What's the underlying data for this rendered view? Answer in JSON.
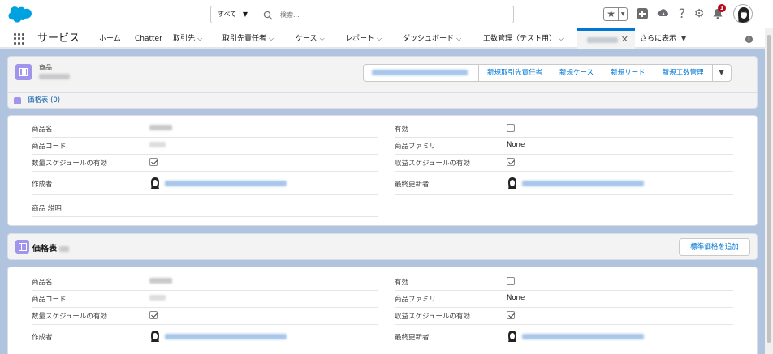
{
  "header": {
    "search_scope": "すべて",
    "search_placeholder": "検索...",
    "notification_count": "1"
  },
  "nav": {
    "app_name": "サービス",
    "items": [
      {
        "label": "ホーム"
      },
      {
        "label": "Chatter"
      },
      {
        "label": "取引先"
      },
      {
        "label": "取引先責任者"
      },
      {
        "label": "ケース"
      },
      {
        "label": "レポート"
      },
      {
        "label": "ダッシュボード"
      },
      {
        "label": "工数管理（テスト用）"
      }
    ],
    "more_label": "さらに表示"
  },
  "record_header": {
    "object_type": "商品",
    "actions": [
      "新規取引先責任者",
      "新規ケース",
      "新規リード",
      "新規工数管理"
    ],
    "related_link": "価格表 (0)"
  },
  "fields_labels": {
    "product_name": "商品名",
    "product_code": "商品コード",
    "qty_schedule": "数量スケジュールの有効",
    "created_by": "作成者",
    "description": "商品 説明",
    "active": "有効",
    "family": "商品ファミリ",
    "revenue_schedule": "収益スケジュールの有効",
    "modified_by": "最終更新者"
  },
  "detail1": {
    "family_value": "None",
    "active": false,
    "qty_schedule": true,
    "revenue_schedule": true
  },
  "pricebook": {
    "title": "価格表",
    "add_button": "標準価格を追加"
  },
  "detail2": {
    "family_value": "None",
    "active": false,
    "qty_schedule": true,
    "revenue_schedule": true
  },
  "colors": {
    "brand_blue": "#0176d3",
    "object_icon": "#a094ed",
    "page_bg": "#b0c4df",
    "notification_red": "#ba0517"
  },
  "icons": [
    "salesforce-cloud-logo",
    "search-icon",
    "star-icon",
    "add-icon",
    "trailhead-icon",
    "help-icon",
    "gear-icon",
    "bell-icon",
    "app-launcher-icon",
    "info-icon",
    "close-icon",
    "chevron-down-icon",
    "pricebook-object-icon",
    "user-avatar"
  ]
}
